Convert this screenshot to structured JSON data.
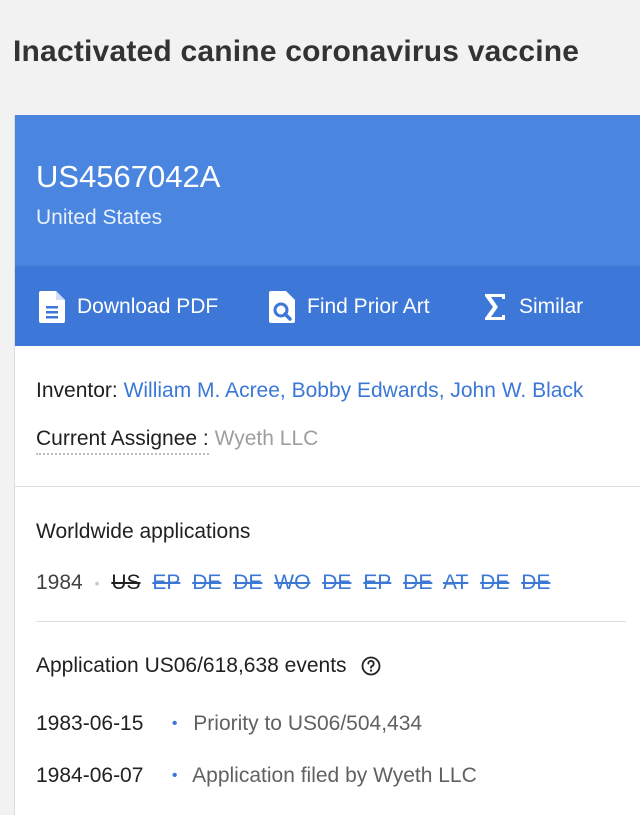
{
  "page": {
    "title": "Inactivated canine coronavirus vaccine"
  },
  "header": {
    "patent_number": "US4567042A",
    "country": "United States"
  },
  "actions": [
    {
      "label": "Download PDF",
      "icon": "pdf-file-icon"
    },
    {
      "label": "Find Prior Art",
      "icon": "find-prior-art-icon"
    },
    {
      "label": "Similar",
      "icon": "sigma-icon"
    }
  ],
  "people": {
    "inventor_label": "Inventor:",
    "inventors": [
      "William M. Acree",
      "Bobby Edwards",
      "John W. Black"
    ],
    "inventor_separator": ", ",
    "assignee_label": "Current Assignee :",
    "assignee": "Wyeth LLC"
  },
  "worldwide": {
    "heading": "Worldwide applications",
    "year": "1984",
    "separator": "•",
    "current_country": "US",
    "countries": [
      "EP",
      "DE",
      "DE",
      "WO",
      "DE",
      "EP",
      "DE",
      "AT",
      "DE",
      "DE"
    ]
  },
  "events": {
    "heading": "Application US06/618,638 events",
    "help_icon": "help-circle-icon",
    "items": [
      {
        "date": "1983-06-15",
        "bullet": "•",
        "description": "Priority to US06/504,434"
      },
      {
        "date": "1984-06-07",
        "bullet": "•",
        "description": "Application filed by Wyeth LLC"
      }
    ]
  },
  "colors": {
    "header_bg": "#4a86e0",
    "actionbar_bg": "#3d78d8",
    "link": "#3b78d6",
    "page_bg": "#f2f2f2"
  }
}
